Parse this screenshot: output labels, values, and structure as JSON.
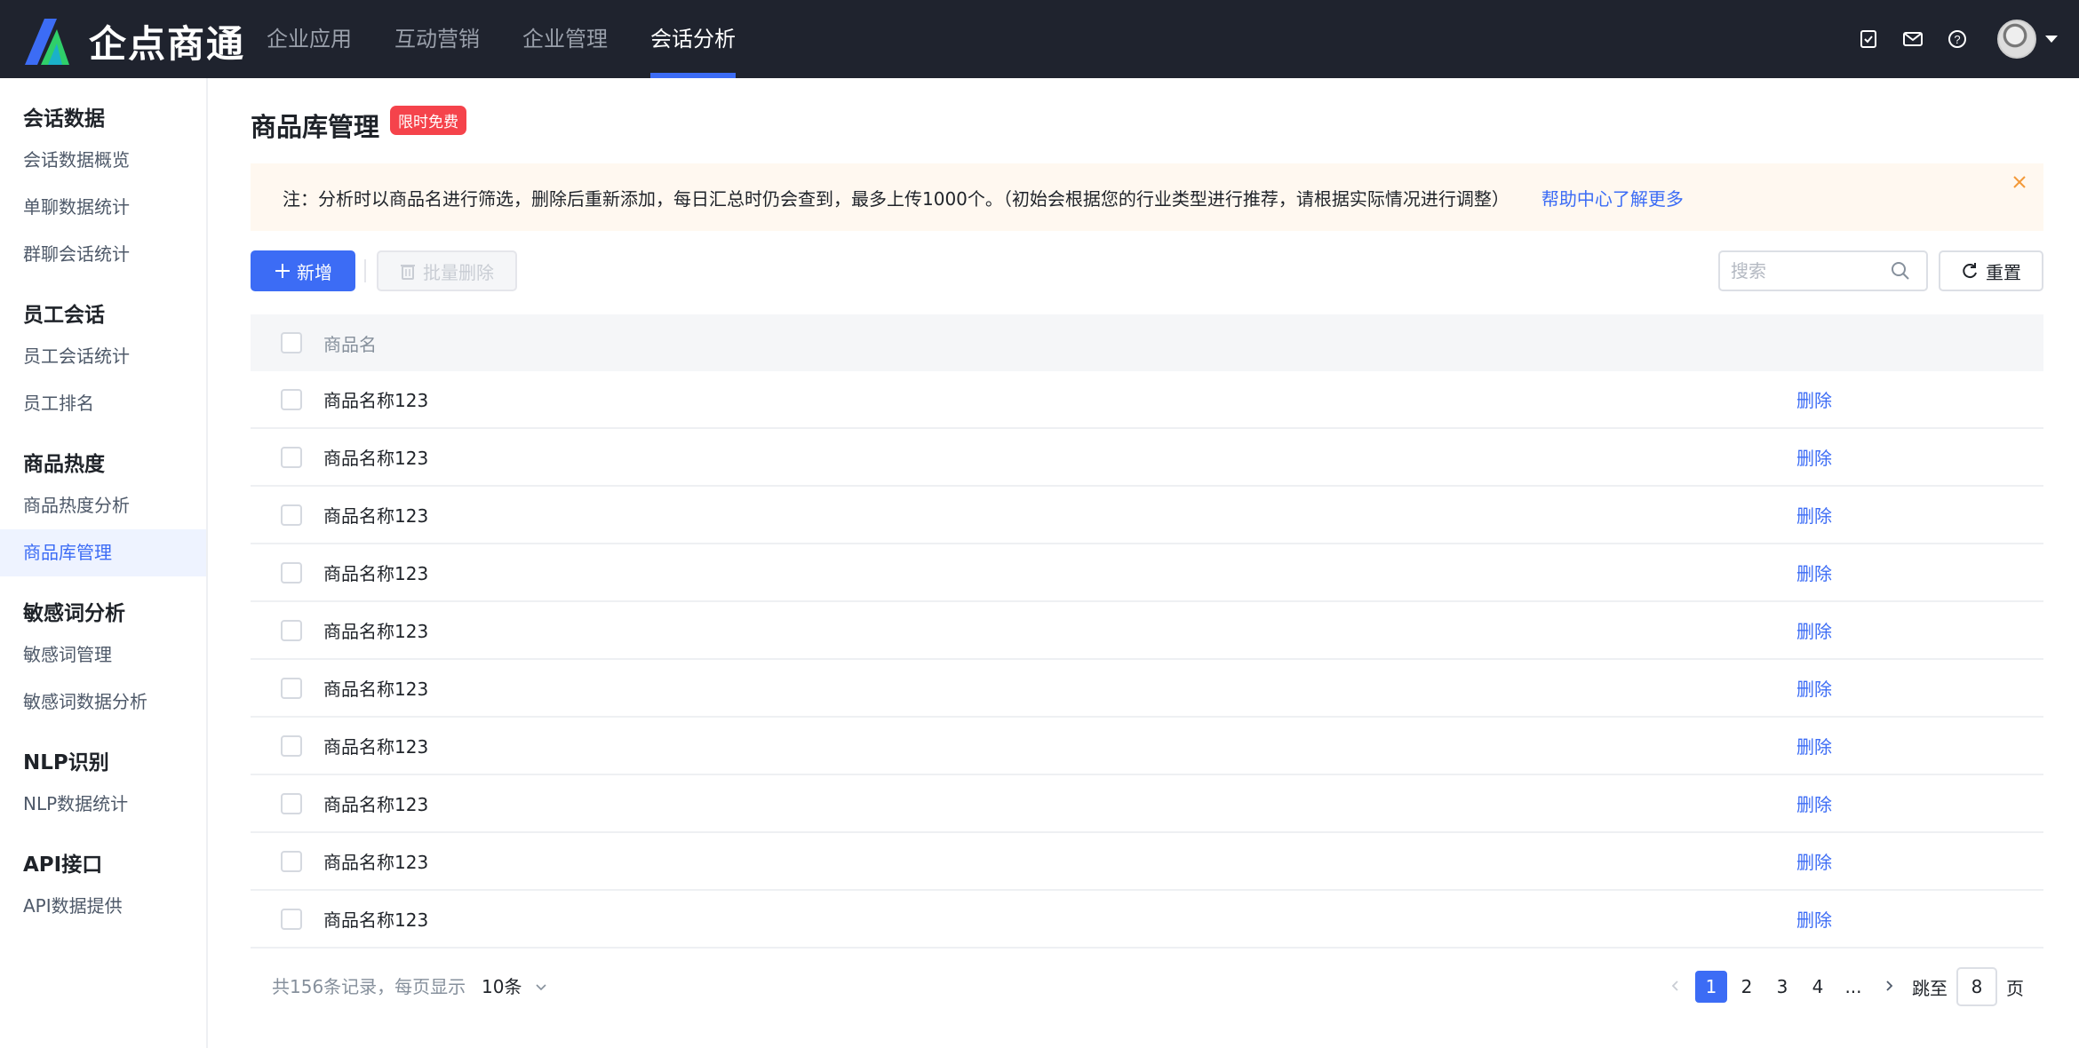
{
  "app": {
    "brand": "企点商通"
  },
  "nav": {
    "items": [
      {
        "label": "企业应用"
      },
      {
        "label": "互动营销"
      },
      {
        "label": "企业管理"
      },
      {
        "label": "会话分析"
      }
    ],
    "active": "会话分析"
  },
  "sidebar": {
    "groups": [
      {
        "title": "会话数据",
        "items": [
          "会话数据概览",
          "单聊数据统计",
          "群聊会话统计"
        ]
      },
      {
        "title": "员工会话",
        "items": [
          "员工会话统计",
          "员工排名"
        ]
      },
      {
        "title": "商品热度",
        "items": [
          "商品热度分析",
          "商品库管理"
        ]
      },
      {
        "title": "敏感词分析",
        "items": [
          "敏感词管理",
          "敏感词数据分析"
        ]
      },
      {
        "title": "NLP识别",
        "items": [
          "NLP数据统计"
        ]
      },
      {
        "title": "API接口",
        "items": [
          "API数据提供"
        ]
      }
    ],
    "active_item": "商品库管理"
  },
  "page": {
    "title": "商品库管理",
    "badge": "限时免费"
  },
  "notice": {
    "text": "注：分析时以商品名进行筛选，删除后重新添加，每日汇总时仍会查到，最多上传1000个。（初始会根据您的行业类型进行推荐，请根据实际情况进行调整）",
    "link": "帮助中心了解更多"
  },
  "toolbar": {
    "add_label": "新增",
    "batch_delete_label": "批量删除",
    "search_placeholder": "搜索",
    "reset_label": "重置"
  },
  "table": {
    "header": "商品名",
    "delete_label": "删除",
    "rows": [
      "商品名称123",
      "商品名称123",
      "商品名称123",
      "商品名称123",
      "商品名称123",
      "商品名称123",
      "商品名称123",
      "商品名称123",
      "商品名称123",
      "商品名称123"
    ]
  },
  "pagination": {
    "total_text": "共156条记录，每页显示",
    "page_size": "10条",
    "pages": [
      "1",
      "2",
      "3",
      "4",
      "..."
    ],
    "current": "1",
    "jump_label": "跳至",
    "jump_value": "8",
    "page_suffix": "页"
  },
  "colors": {
    "accent": "#3c6cf5",
    "topbar": "#1f232e",
    "badge": "#f5434b",
    "notice_bg": "#fff8f0"
  }
}
